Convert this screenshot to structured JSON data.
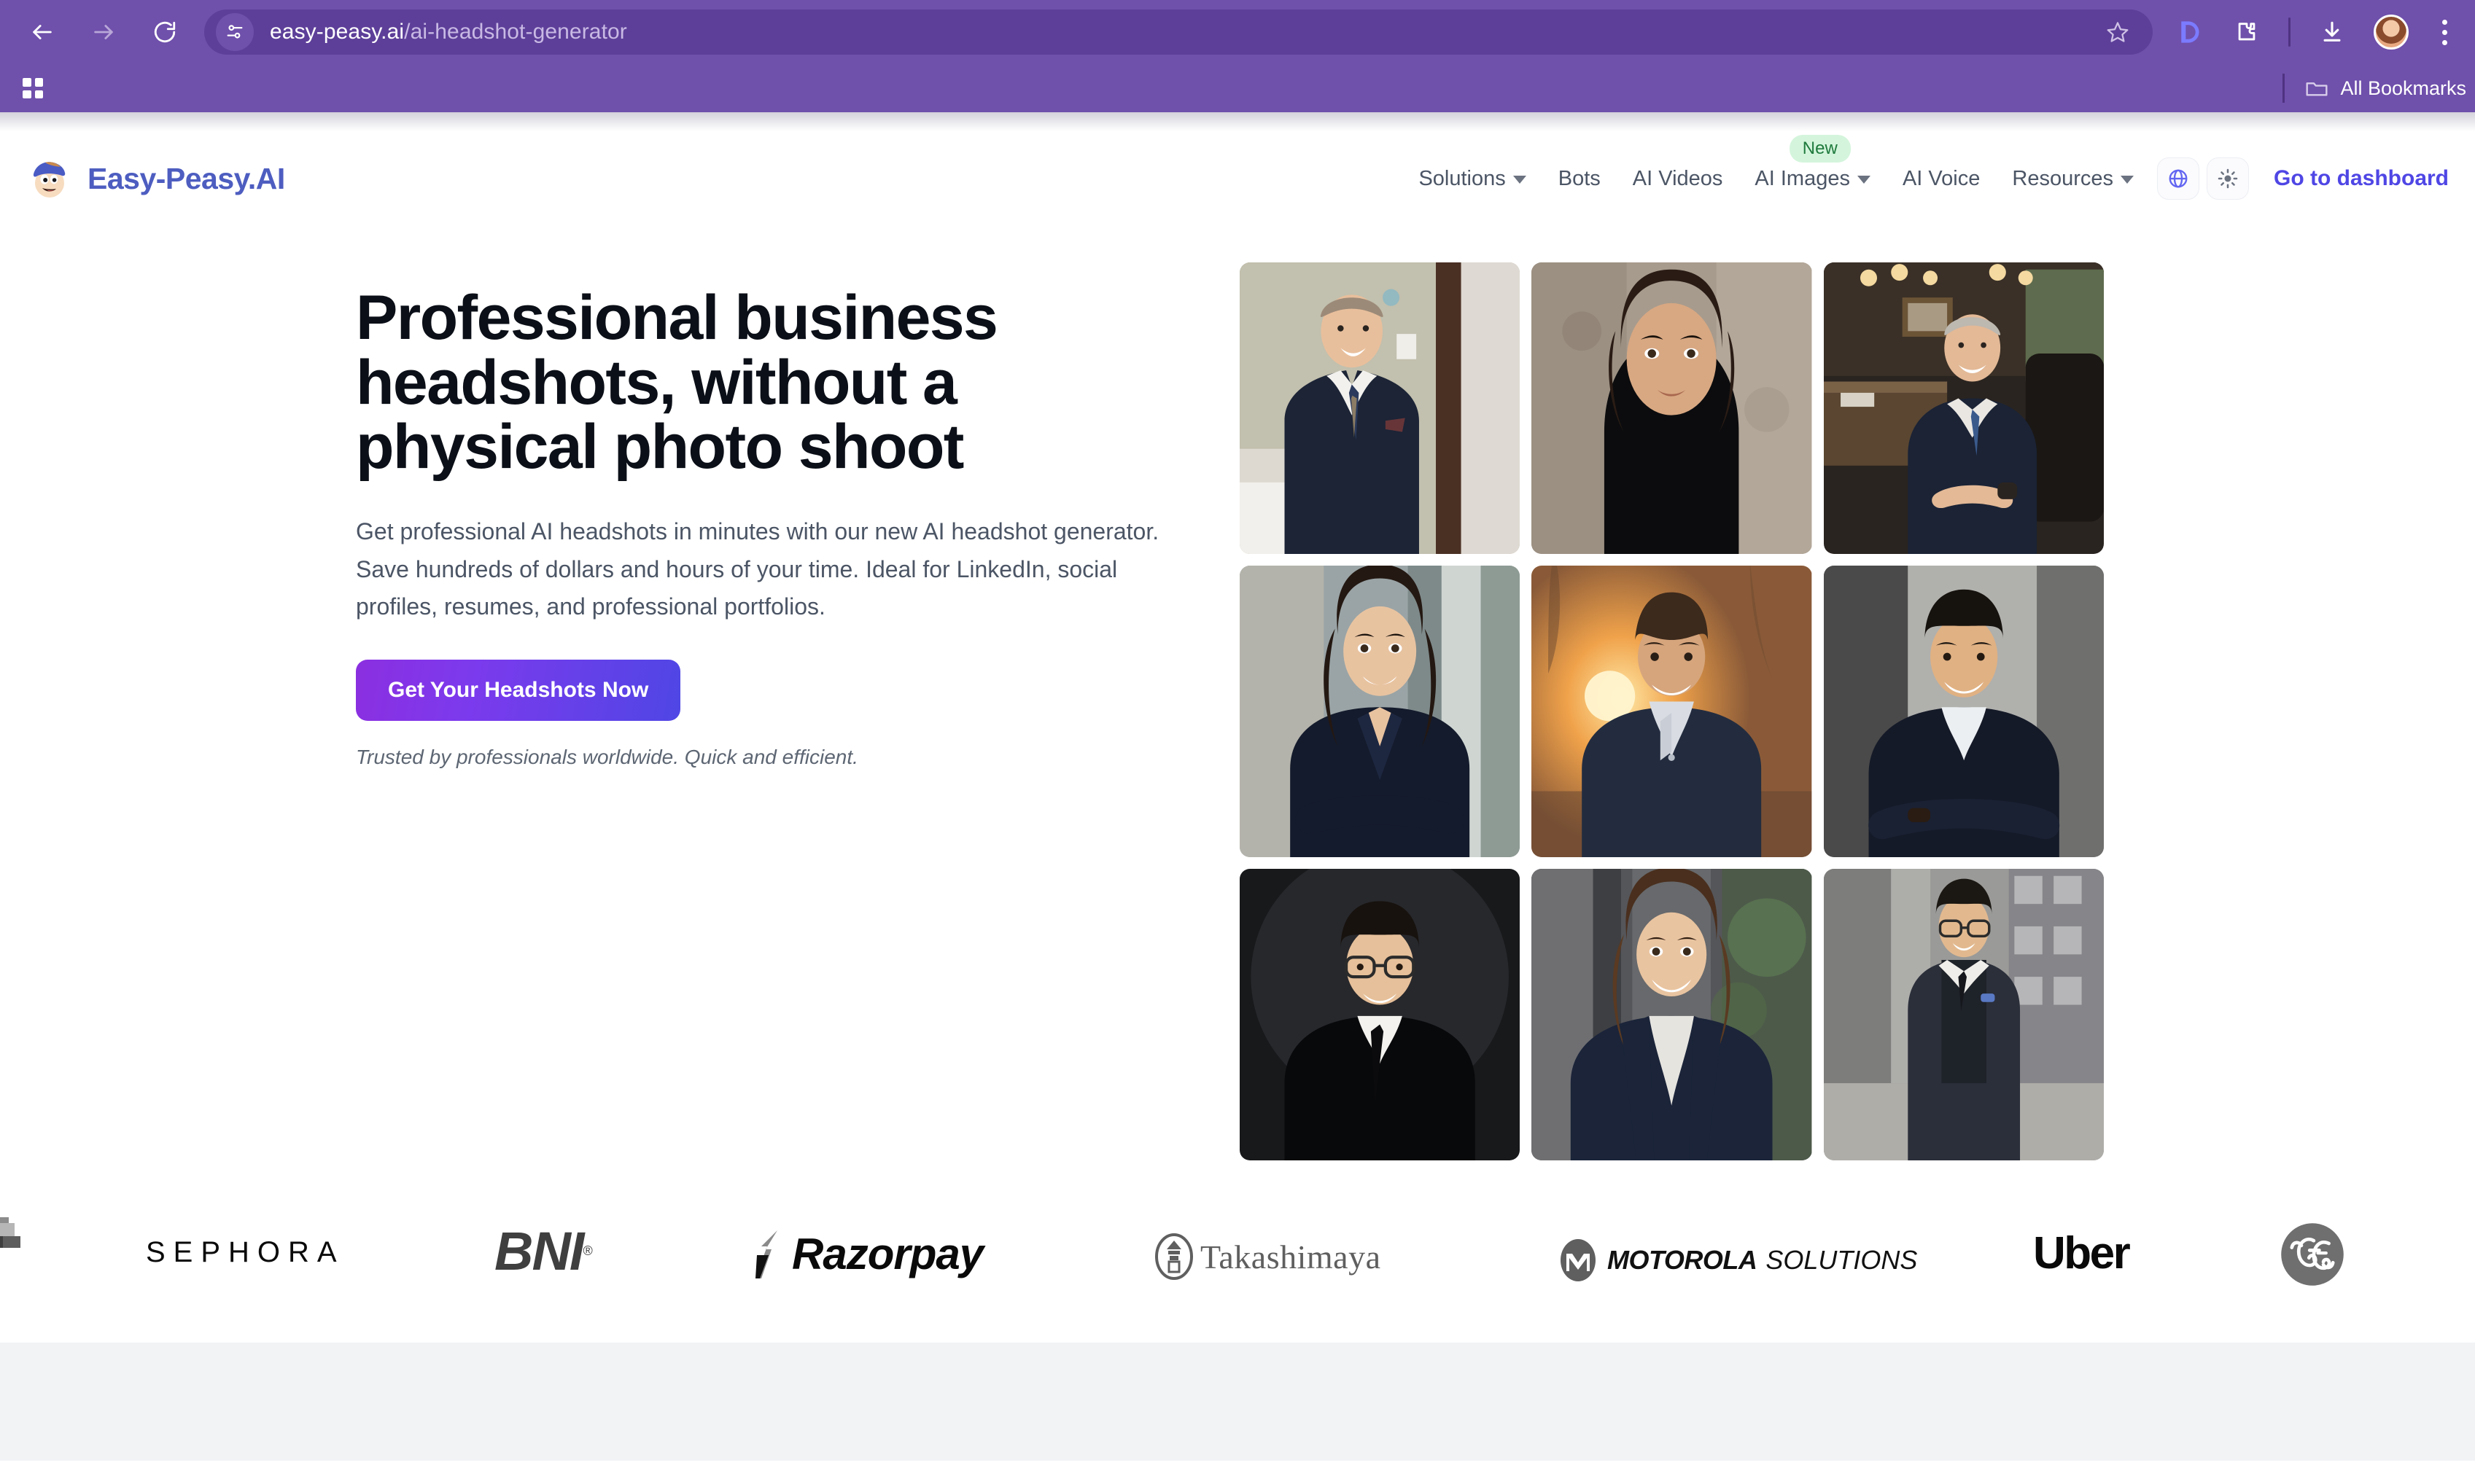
{
  "browser": {
    "back_icon": "back-arrow-icon",
    "forward_icon": "forward-arrow-icon",
    "reload_icon": "reload-icon",
    "site_info_icon": "site-settings-icon",
    "url_domain": "easy-peasy.ai",
    "url_path": "/ai-headshot-generator",
    "bookmark_star_icon": "star-icon",
    "extension_d_icon": "extension-d-icon",
    "extensions_icon": "extensions-puzzle-icon",
    "downloads_icon": "download-icon",
    "profile_avatar": "profile-avatar",
    "menu_icon": "kebab-menu-icon",
    "apps_icon": "apps-grid-icon",
    "all_bookmarks_label": "All Bookmarks",
    "folder_icon": "folder-icon",
    "chrome_bg": "#6f50ab"
  },
  "site_header": {
    "logo_text": "Easy-Peasy.AI",
    "logo_icon": "easy-peasy-mascot-icon",
    "nav": [
      {
        "label": "Solutions",
        "has_dropdown": true,
        "badge": null
      },
      {
        "label": "Bots",
        "has_dropdown": false,
        "badge": null
      },
      {
        "label": "AI Videos",
        "has_dropdown": false,
        "badge": null
      },
      {
        "label": "AI Images",
        "has_dropdown": true,
        "badge": "New"
      },
      {
        "label": "AI Voice",
        "has_dropdown": false,
        "badge": null
      },
      {
        "label": "Resources",
        "has_dropdown": true,
        "badge": null
      }
    ],
    "language_icon": "globe-icon",
    "theme_icon": "sun-icon",
    "dashboard_link": "Go to dashboard",
    "accent_color": "#4f46e5",
    "logo_color": "#4d5dc0",
    "badge_bg": "#d4f5dc",
    "badge_color": "#1f7a3d"
  },
  "hero": {
    "heading": "Professional business headshots, without a physical photo shoot",
    "paragraph": "Get professional AI headshots in minutes with our new AI headshot generator. Save hundreds of dollars and hours of your time. Ideal for LinkedIn, social profiles, resumes, and professional portfolios.",
    "cta_label": "Get Your Headshots Now",
    "trust_text": "Trusted by professionals worldwide. Quick and efficient.",
    "cta_gradient_from": "#8b2fe0",
    "cta_gradient_to": "#4f46e5",
    "gallery": [
      {
        "name": "headshot-man-suit-indoor-room",
        "alt": "Smiling bald man in navy suit and patterned tie, bedroom background"
      },
      {
        "name": "headshot-woman-black-turtleneck",
        "alt": "Woman with dark hair in black turtleneck, neutral stone backdrop"
      },
      {
        "name": "headshot-senior-man-office-desk",
        "alt": "Silver-haired executive seated at desk in warm-lit office"
      },
      {
        "name": "headshot-woman-navy-blazer-hallway",
        "alt": "Smiling woman in navy blazer, bright hallway background"
      },
      {
        "name": "headshot-man-sunset-outdoor",
        "alt": "Smiling man in blazer and open shirt with sunset behind"
      },
      {
        "name": "headshot-man-dark-suit-arms-crossed",
        "alt": "Man in dark suit with arms crossed, grey wall"
      },
      {
        "name": "headshot-man-glasses-black-backdrop",
        "alt": "Man with glasses in black suit and tie on black backdrop"
      },
      {
        "name": "headshot-woman-city-street",
        "alt": "Smiling woman in navy blazer on blurred city street"
      },
      {
        "name": "headshot-man-three-piece-city",
        "alt": "Man with glasses in three-piece suit standing in modern street"
      }
    ]
  },
  "logobar": {
    "logos": [
      {
        "name": "partial-logo-left",
        "text": "",
        "style": "partial"
      },
      {
        "name": "sephora-logo",
        "text": "SEPHORA",
        "style": "sephora"
      },
      {
        "name": "bni-logo",
        "text": "BNI",
        "style": "bni"
      },
      {
        "name": "razorpay-logo",
        "text": "Razorpay",
        "style": "razorpay"
      },
      {
        "name": "takashimaya-logo",
        "text": "Takashimaya",
        "style": "takashimaya"
      },
      {
        "name": "motorola-solutions-logo",
        "text": "MOTOROLA",
        "text2": "SOLUTIONS",
        "style": "motorola"
      },
      {
        "name": "uber-logo",
        "text": "Uber",
        "style": "uber"
      },
      {
        "name": "ge-logo",
        "text": "",
        "style": "ge"
      }
    ]
  }
}
